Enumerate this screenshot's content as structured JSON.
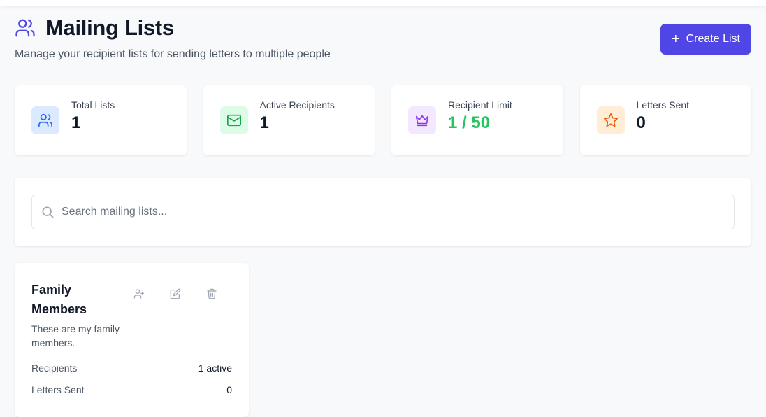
{
  "header": {
    "title": "Mailing Lists",
    "subtitle": "Manage your recipient lists for sending letters to multiple people",
    "create_button": "Create List"
  },
  "colors": {
    "accent": "#4f46e5",
    "limit_value": "#22c55e"
  },
  "stats": [
    {
      "label": "Total Lists",
      "value": "1",
      "icon": "users-icon",
      "icon_bg": "#dbeafe",
      "icon_color": "#2563eb"
    },
    {
      "label": "Active Recipients",
      "value": "1",
      "icon": "mail-icon",
      "icon_bg": "#dcfce7",
      "icon_color": "#16a34a"
    },
    {
      "label": "Recipient Limit",
      "value": "1 / 50",
      "icon": "crown-icon",
      "icon_bg": "#f3e8ff",
      "icon_color": "#9333ea"
    },
    {
      "label": "Letters Sent",
      "value": "0",
      "icon": "star-icon",
      "icon_bg": "#ffedd5",
      "icon_color": "#ea580c"
    }
  ],
  "search": {
    "placeholder": "Search mailing lists...",
    "value": ""
  },
  "lists": [
    {
      "name": "Family Members",
      "description": "These are my family members.",
      "recipients_label": "Recipients",
      "recipients_value": "1 active",
      "letters_label": "Letters Sent",
      "letters_value": "0"
    }
  ]
}
